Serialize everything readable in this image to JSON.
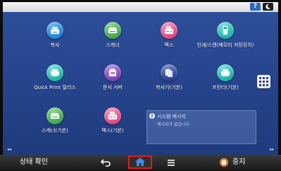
{
  "topbar": {
    "help_label": "?",
    "sleep_icon": "moon-icon"
  },
  "apps": {
    "copy": {
      "label": "복사",
      "icon": "copy-icon",
      "color": "#1f82d8"
    },
    "scanner": {
      "label": "스캐너",
      "icon": "scanner-icon",
      "color": "#3ea64a"
    },
    "fax": {
      "label": "팩스",
      "icon": "fax-icon",
      "color": "#e2457f"
    },
    "printscan": {
      "label": "인쇄/스캔(메모리 저장장치)",
      "icon": "memory-storage-icon",
      "color": "#1bb3a6"
    },
    "quickprint": {
      "label": "Quick Print 릴리스",
      "icon": "quick-print-icon",
      "color": "#1bb3a6"
    },
    "docserver": {
      "label": "문서 서버",
      "icon": "document-server-icon",
      "color": "#7b3fb0"
    },
    "copier_classic": {
      "label": "복사기(기본)",
      "icon": "copier-classic-icon",
      "color": "#2a3e8c"
    },
    "printer_classic": {
      "label": "프린터(기본)",
      "icon": "printer-classic-icon",
      "color": "#1bb3a6"
    },
    "scanner_classic": {
      "label": "스캐너(기본)",
      "icon": "scanner-classic-icon",
      "color": "#3ea64a"
    },
    "fax_classic": {
      "label": "팩스(기본)",
      "icon": "fax-classic-icon",
      "color": "#e2457f"
    }
  },
  "app_list_button": {
    "icon": "app-grid-icon"
  },
  "message_widget": {
    "title": "시스템 메시지",
    "text": "메시지가 없습니다."
  },
  "pager": {
    "left": "◂◂",
    "right": "▸▸"
  },
  "bottombar": {
    "status_label": "상태 확인",
    "back_icon": "back-arrow-icon",
    "home_icon": "home-icon",
    "menu_icon": "menu-icon",
    "stop_label": "중지",
    "stop_icon": "stop-icon",
    "home_highlight_color": "#e21b1b"
  }
}
